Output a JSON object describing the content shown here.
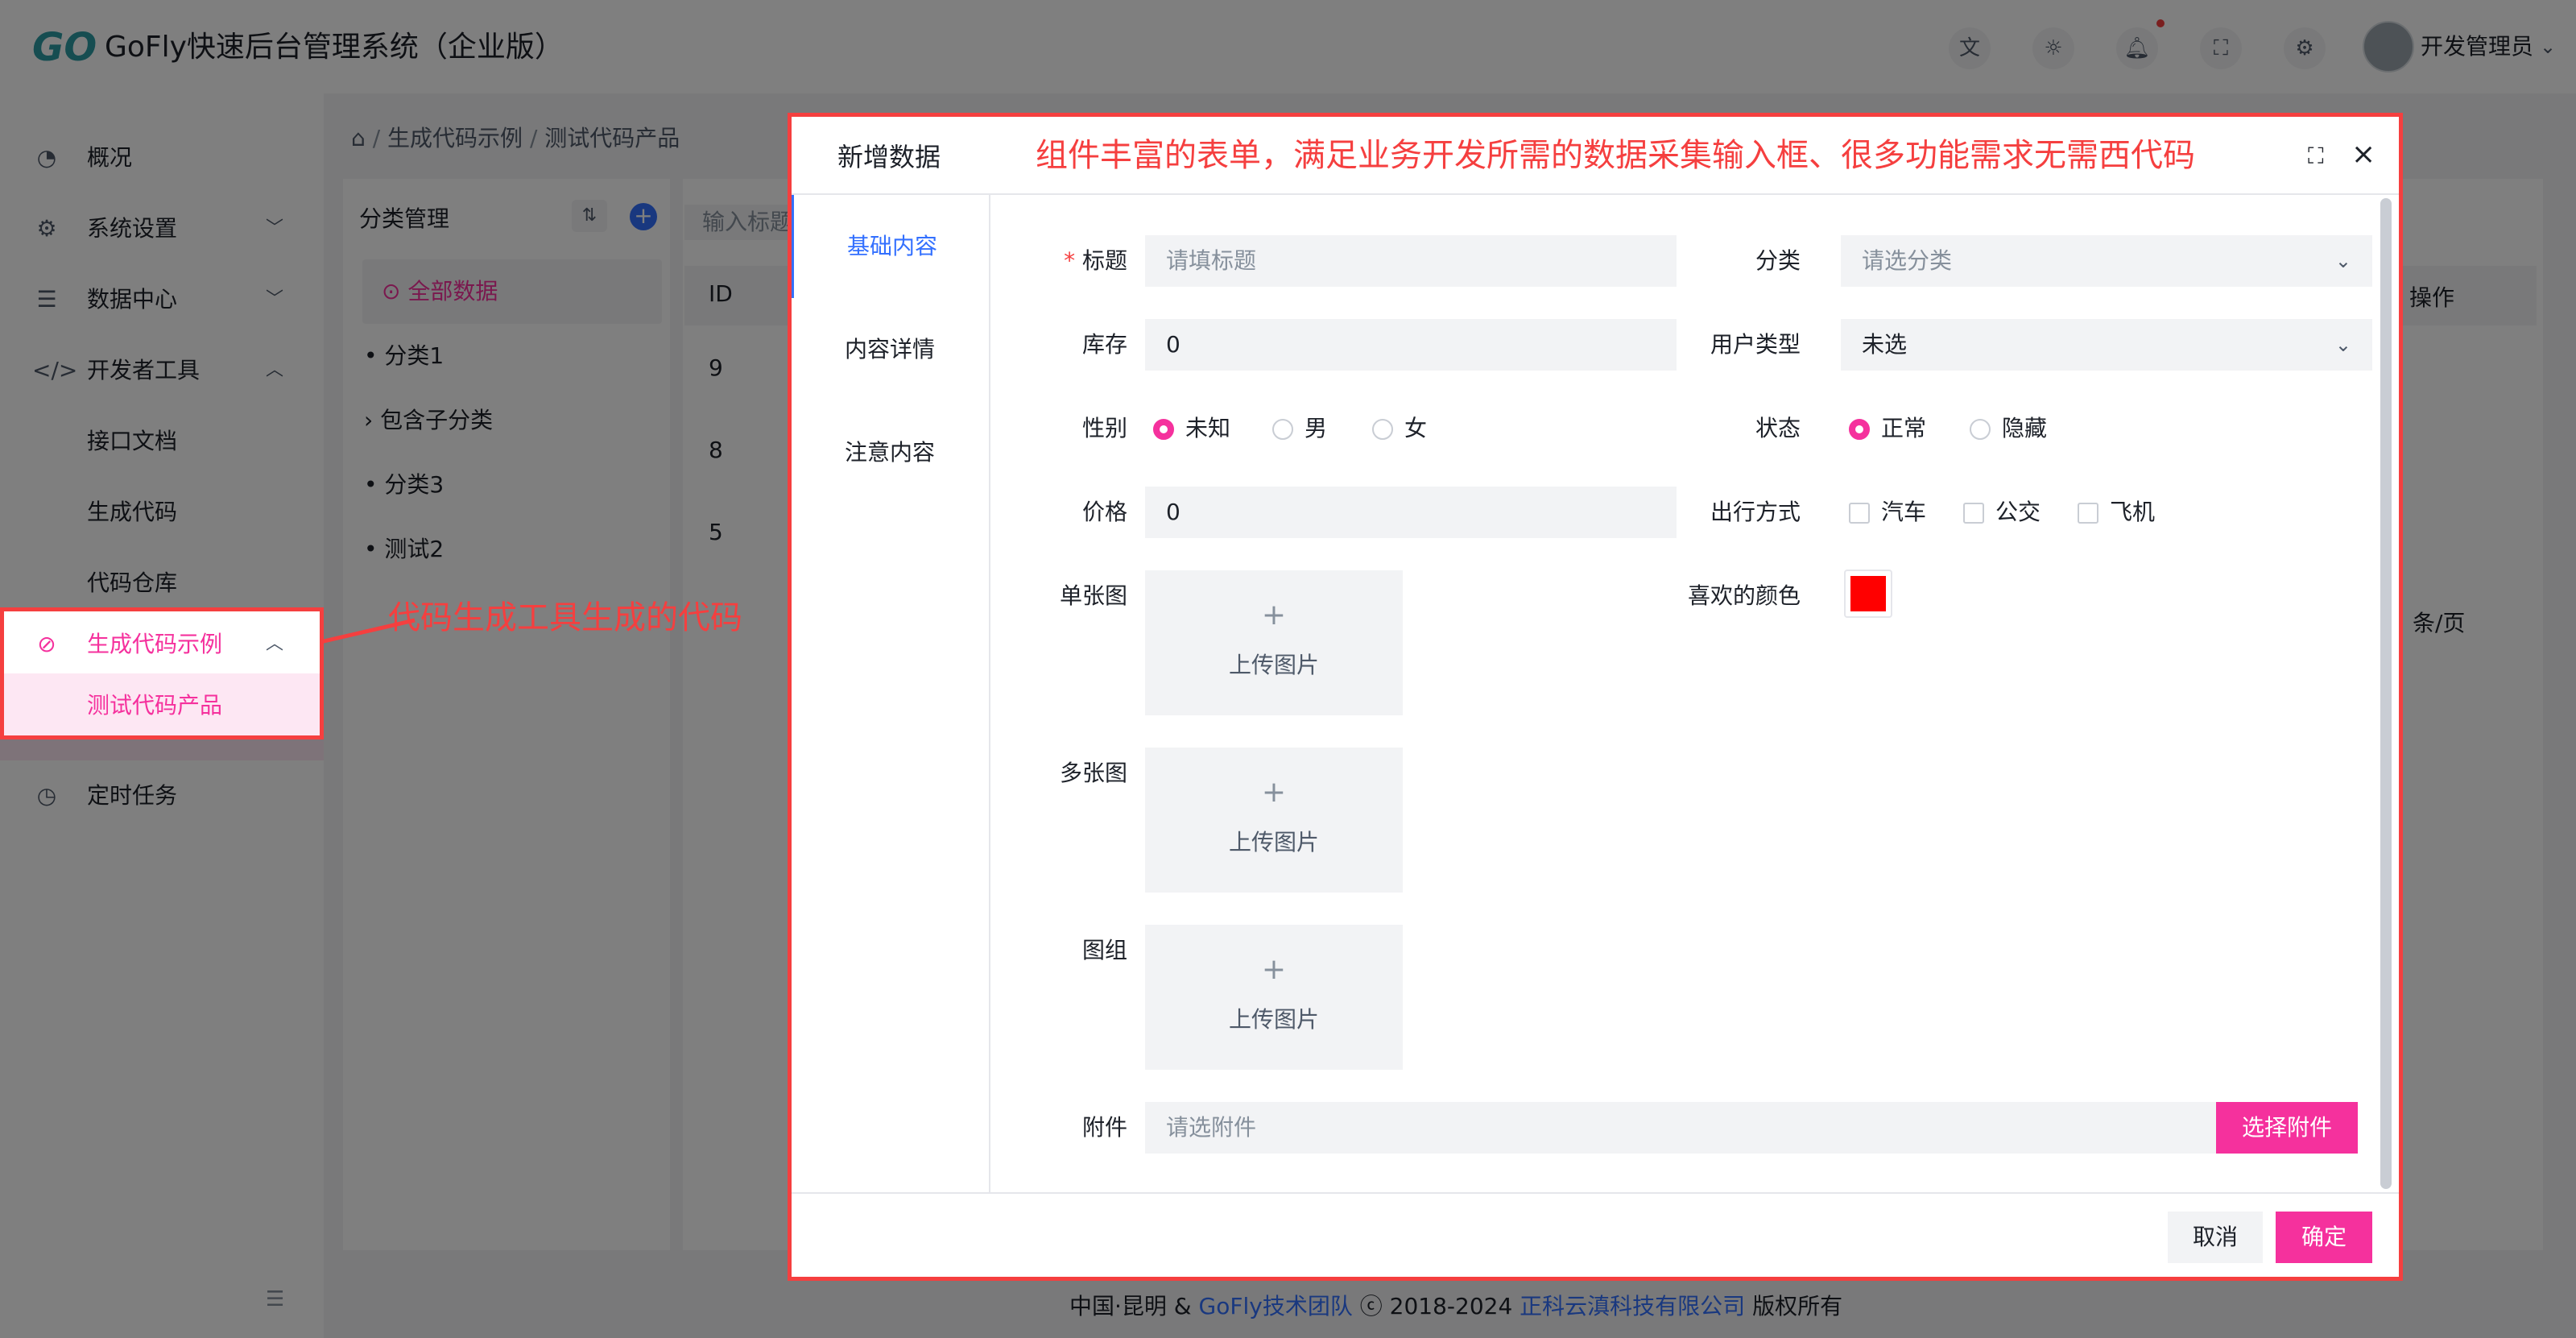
{
  "header": {
    "logo_text": "GO",
    "app_title": "GoFly快速后台管理系统（企业版）",
    "icons": [
      "translate-icon",
      "theme-icon",
      "bell-icon",
      "fullscreen-icon",
      "settings-icon"
    ],
    "username": "开发管理员"
  },
  "sidebar": {
    "items": [
      {
        "label": "概况",
        "icon": "dashboard-icon"
      },
      {
        "label": "系统设置",
        "icon": "gear-icon"
      },
      {
        "label": "数据中心",
        "icon": "database-icon"
      },
      {
        "label": "开发者工具",
        "icon": "code-icon"
      },
      {
        "label": "接口文档"
      },
      {
        "label": "生成代码"
      },
      {
        "label": "代码仓库"
      },
      {
        "label": "生成代码示例",
        "icon": "compass-icon"
      },
      {
        "label": "测试代码产品"
      },
      {
        "label": "定时任务",
        "icon": "clock-icon"
      }
    ]
  },
  "breadcrumb": {
    "items": [
      "生成代码示例",
      "测试代码产品"
    ]
  },
  "tree": {
    "title": "分类管理",
    "items": [
      "全部数据",
      "分类1",
      "包含子分类",
      "分类3",
      "测试2"
    ]
  },
  "table": {
    "search_placeholder": "输入标题",
    "columns": [
      "ID",
      "操作"
    ],
    "rows": [
      "9",
      "8",
      "5"
    ],
    "page_size_suffix": "条/页"
  },
  "footer": {
    "prefix": "中国·昆明 & ",
    "team": "GoFly技术团队",
    "mid": " ⓒ 2018-2024 ",
    "company": "正科云滇科技有限公司",
    "suffix": " 版权所有"
  },
  "annotations": {
    "top_note": "组件丰富的表单，满足业务开发所需的数据采集输入框、很多功能需求无需西代码",
    "side_note": "代码生成工具生成的代码"
  },
  "modal": {
    "title": "新增数据",
    "tabs": [
      "基础内容",
      "内容详情",
      "注意内容"
    ],
    "fields": {
      "title_label": "标题",
      "title_placeholder": "请填标题",
      "category_label": "分类",
      "category_placeholder": "请选分类",
      "stock_label": "库存",
      "stock_value": "0",
      "user_type_label": "用户类型",
      "user_type_value": "未选",
      "gender_label": "性别",
      "gender_options": [
        "未知",
        "男",
        "女"
      ],
      "status_label": "状态",
      "status_options": [
        "正常",
        "隐藏"
      ],
      "price_label": "价格",
      "price_value": "0",
      "travel_label": "出行方式",
      "travel_options": [
        "汽车",
        "公交",
        "飞机"
      ],
      "single_image_label": "单张图",
      "multi_image_label": "多张图",
      "image_group_label": "图组",
      "upload_text": "上传图片",
      "favorite_color_label": "喜欢的颜色",
      "favorite_color": "#ff0000",
      "attachment_label": "附件",
      "attachment_placeholder": "请选附件",
      "attachment_button": "选择附件"
    },
    "cancel": "取消",
    "confirm": "确定"
  },
  "colors": {
    "accent": "#f5319d",
    "link": "#3370ff",
    "annotation": "#f53f3f"
  }
}
